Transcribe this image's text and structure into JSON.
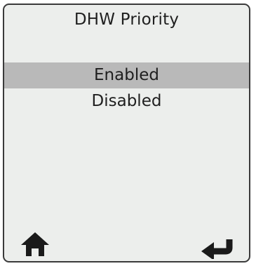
{
  "screen": {
    "title": "DHW Priority",
    "options": [
      {
        "label": "Enabled",
        "selected": true
      },
      {
        "label": "Disabled",
        "selected": false
      }
    ]
  },
  "footer": {
    "home_icon": "home-icon",
    "back_icon": "back-arrow-icon"
  },
  "colors": {
    "screen_background": "#eceeec",
    "selected_row": "#b9b9b9",
    "border": "#3a3a3a",
    "text": "#1f1f1f"
  }
}
